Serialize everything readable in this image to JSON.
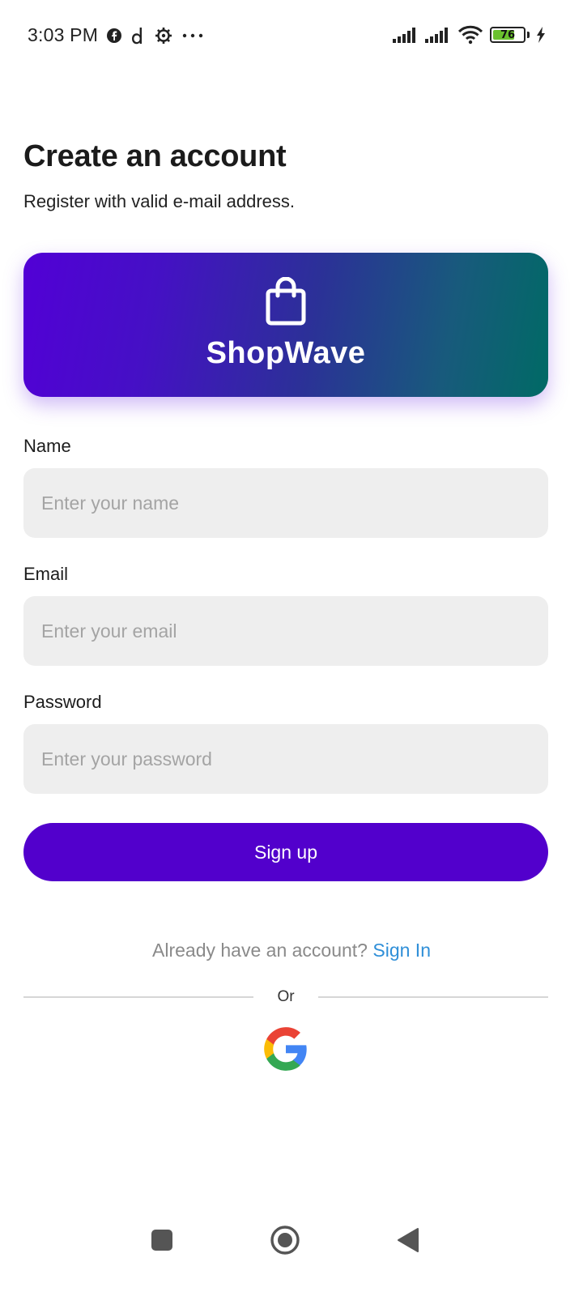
{
  "status_bar": {
    "time": "3:03 PM",
    "battery_percent": 76,
    "battery_label": "76",
    "left_icons": [
      "facebook-icon",
      "d-app-icon",
      "settings-gear-icon",
      "more-dots-icon"
    ],
    "right_icons": [
      "signal-icon",
      "signal-icon",
      "wifi-icon",
      "battery-icon",
      "charging-icon"
    ]
  },
  "header": {
    "title": "Create an account",
    "subtitle": "Register with valid e-mail address."
  },
  "banner": {
    "brand_name": "ShopWave",
    "icon": "shopping-bag-icon",
    "gradient_start": "#5200d6",
    "gradient_end": "#006a65"
  },
  "form": {
    "name": {
      "label": "Name",
      "placeholder": "Enter your name"
    },
    "email": {
      "label": "Email",
      "placeholder": "Enter your email"
    },
    "password": {
      "label": "Password",
      "placeholder": "Enter your password"
    },
    "submit_label": "Sign up",
    "accent_color": "#5200cc"
  },
  "signin": {
    "prompt": "Already have an account?",
    "link_label": "Sign In",
    "link_color": "#2f8fd8"
  },
  "divider": {
    "label": "Or"
  },
  "social": {
    "google_icon": "google-icon"
  },
  "nav_bar": {
    "buttons": [
      "recent-apps-icon",
      "home-icon",
      "back-icon"
    ]
  }
}
